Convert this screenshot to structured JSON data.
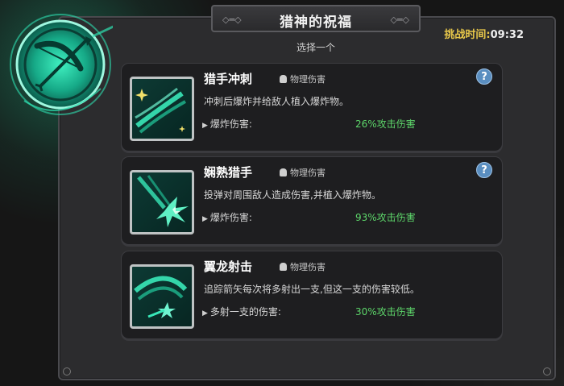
{
  "header": {
    "title": "猎神的祝福",
    "subtitle": "选择一个",
    "timer_label": "挑战时间:",
    "timer_value": "09:32"
  },
  "cards": [
    {
      "name": "猎手冲刺",
      "damage_type": "物理伤害",
      "description": "冲刺后爆炸并给敌人植入爆炸物。",
      "stat_label": "爆炸伤害:",
      "stat_value": "26%攻击伤害",
      "has_help": true,
      "help_label": "?"
    },
    {
      "name": "娴熟猎手",
      "damage_type": "物理伤害",
      "description": "投弹对周围敌人造成伤害,并植入爆炸物。",
      "stat_label": "爆炸伤害:",
      "stat_value": "93%攻击伤害",
      "has_help": true,
      "help_label": "?"
    },
    {
      "name": "翼龙射击",
      "damage_type": "物理伤害",
      "description": "追踪箭矢每次将多射出一支,但这一支的伤害较低。",
      "stat_label": "多射一支的伤害:",
      "stat_value": "30%攻击伤害",
      "has_help": false
    }
  ],
  "colors": {
    "accent": "#1edca0",
    "value_green": "#5dd66a",
    "timer_label": "#e8c84a"
  },
  "icons": {
    "emblem": "bow-emblem-icon",
    "damage_type": "fist-icon",
    "help": "question-icon"
  }
}
